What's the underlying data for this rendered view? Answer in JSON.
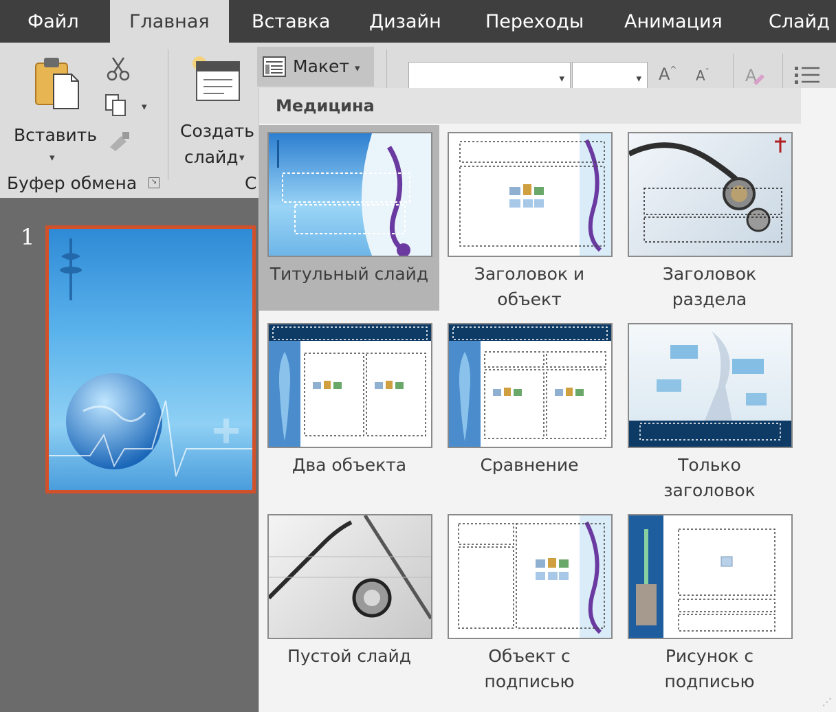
{
  "tabs": [
    {
      "label": "Файл",
      "active": false
    },
    {
      "label": "Главная",
      "active": true
    },
    {
      "label": "Вставка",
      "active": false
    },
    {
      "label": "Дизайн",
      "active": false
    },
    {
      "label": "Переходы",
      "active": false
    },
    {
      "label": "Анимация",
      "active": false
    },
    {
      "label": "Слайд",
      "active": false
    }
  ],
  "ribbon": {
    "paste_label": "Вставить",
    "new_slide_line1": "Создать",
    "new_slide_line2": "слайд",
    "layout_label": "Макет",
    "clipboard_group": "Буфер обмена",
    "slides_group_partial": "С",
    "font_grow": "A",
    "font_shrink": "A"
  },
  "slide_panel": {
    "number": "1"
  },
  "gallery": {
    "title": "Медицина",
    "layouts": [
      {
        "caption": "Титульный слайд",
        "selected": true,
        "icon": "title-slide-thumbnail"
      },
      {
        "caption": "Заголовок и\nобъект",
        "selected": false,
        "icon": "title-content-thumbnail"
      },
      {
        "caption": "Заголовок\nраздела",
        "selected": false,
        "icon": "section-header-thumbnail"
      },
      {
        "caption": "Два объекта",
        "selected": false,
        "icon": "two-content-thumbnail"
      },
      {
        "caption": "Сравнение",
        "selected": false,
        "icon": "comparison-thumbnail"
      },
      {
        "caption": "Только\nзаголовок",
        "selected": false,
        "icon": "title-only-thumbnail"
      },
      {
        "caption": "Пустой слайд",
        "selected": false,
        "icon": "blank-thumbnail"
      },
      {
        "caption": "Объект с\nподписью",
        "selected": false,
        "icon": "content-caption-thumbnail"
      },
      {
        "caption": "Рисунок с\nподписью",
        "selected": false,
        "icon": "picture-caption-thumbnail"
      }
    ]
  },
  "colors": {
    "tab_bar": "#3f3f3f",
    "ribbon": "#dcdcdc",
    "selected_cell": "#b4b4b4",
    "slide_border": "#d2502a",
    "theme_blue": "#1e6fbf",
    "theme_navy": "#0e3a66"
  }
}
